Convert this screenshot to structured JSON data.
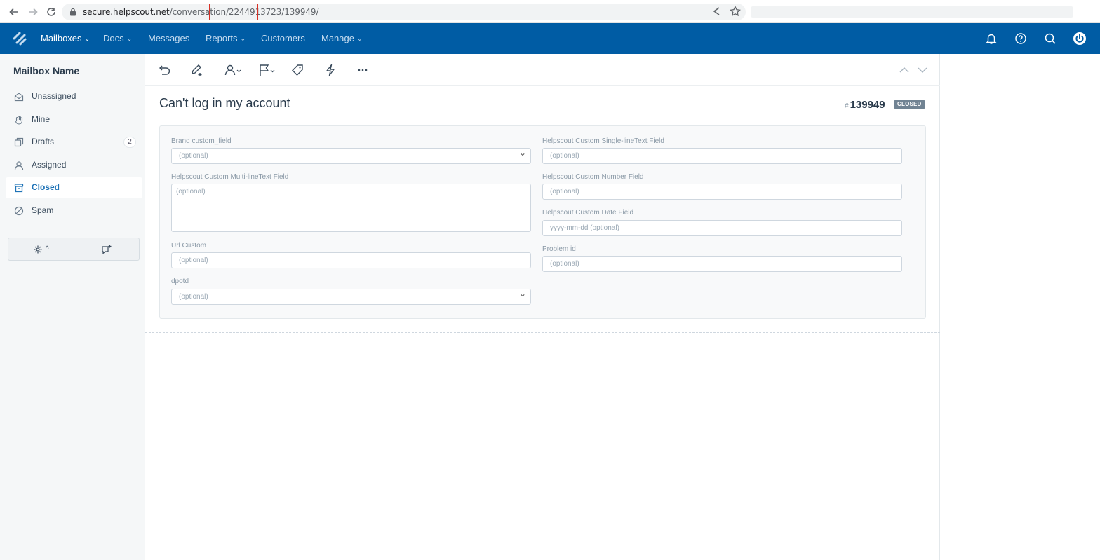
{
  "browser": {
    "url_domain": "secure.helpscout.net",
    "url_path_start": "/conversation/",
    "url_highlighted_segment": "2244913723",
    "url_path_end": "/139949/"
  },
  "header": {
    "nav": [
      {
        "label": "Mailboxes",
        "has_dropdown": true
      },
      {
        "label": "Docs",
        "has_dropdown": true
      },
      {
        "label": "Messages",
        "has_dropdown": false
      },
      {
        "label": "Reports",
        "has_dropdown": true
      },
      {
        "label": "Customers",
        "has_dropdown": false
      },
      {
        "label": "Manage",
        "has_dropdown": true
      }
    ],
    "chevron": "⌄"
  },
  "sidebar": {
    "mailbox_name": "Mailbox Name",
    "items": [
      {
        "label": "Unassigned",
        "icon": "inbox-icon"
      },
      {
        "label": "Mine",
        "icon": "hand-icon"
      },
      {
        "label": "Drafts",
        "icon": "drafts-icon",
        "count": "2"
      },
      {
        "label": "Assigned",
        "icon": "person-icon"
      },
      {
        "label": "Closed",
        "icon": "archive-icon",
        "active": true
      },
      {
        "label": "Spam",
        "icon": "block-icon"
      }
    ],
    "tools_caret": "^"
  },
  "conversation": {
    "subject": "Can't log in my account",
    "hash": "#",
    "number": "139949",
    "status": "CLOSED"
  },
  "custom_fields": {
    "brand": {
      "label": "Brand custom_field",
      "placeholder": "(optional)"
    },
    "multiline": {
      "label": "Helpscout Custom Multi-lineText Field",
      "placeholder": "(optional)"
    },
    "url": {
      "label": "Url Custom",
      "placeholder": "(optional)"
    },
    "dpotd": {
      "label": "dpotd",
      "placeholder": "(optional)"
    },
    "singleline": {
      "label": "Helpscout Custom Single-lineText Field",
      "placeholder": "(optional)"
    },
    "number": {
      "label": "Helpscout Custom Number Field",
      "placeholder": "(optional)"
    },
    "date": {
      "label": "Helpscout Custom Date Field",
      "placeholder": "yyyy-mm-dd (optional)"
    },
    "problem_id": {
      "label": "Problem id",
      "placeholder": "(optional)"
    }
  },
  "colors": {
    "header_bg": "#005ca4",
    "active_link": "#1f73b7",
    "badge_bg": "#718393",
    "highlight_box": "#d93025"
  }
}
